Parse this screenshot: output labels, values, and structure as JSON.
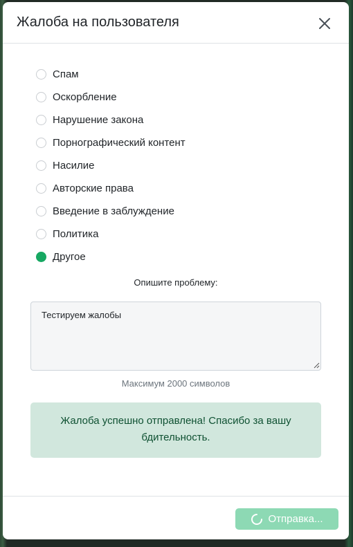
{
  "modal": {
    "title": "Жалоба на пользователя",
    "close_icon": "close-icon"
  },
  "reasons": [
    {
      "label": "Спам",
      "checked": false
    },
    {
      "label": "Оскорбление",
      "checked": false
    },
    {
      "label": "Нарушение закона",
      "checked": false
    },
    {
      "label": "Порнографический контент",
      "checked": false
    },
    {
      "label": "Насилие",
      "checked": false
    },
    {
      "label": "Авторские права",
      "checked": false
    },
    {
      "label": "Введение в заблуждение",
      "checked": false
    },
    {
      "label": "Политика",
      "checked": false
    },
    {
      "label": "Другое",
      "checked": true
    }
  ],
  "description": {
    "label": "Опишите проблему:",
    "value": "Тестируем жалобы",
    "hint": "Максимум 2000 символов"
  },
  "alert": {
    "text": "Жалоба успешно отправлена! Спасибо за вашу бдительность."
  },
  "footer": {
    "submit_label": "Отправка...",
    "submit_icon": "spinner-icon"
  },
  "colors": {
    "accent": "#17a862",
    "submit_disabled": "#8dd9b4",
    "alert_bg": "#d1e7dd",
    "alert_text": "#0f5132"
  }
}
